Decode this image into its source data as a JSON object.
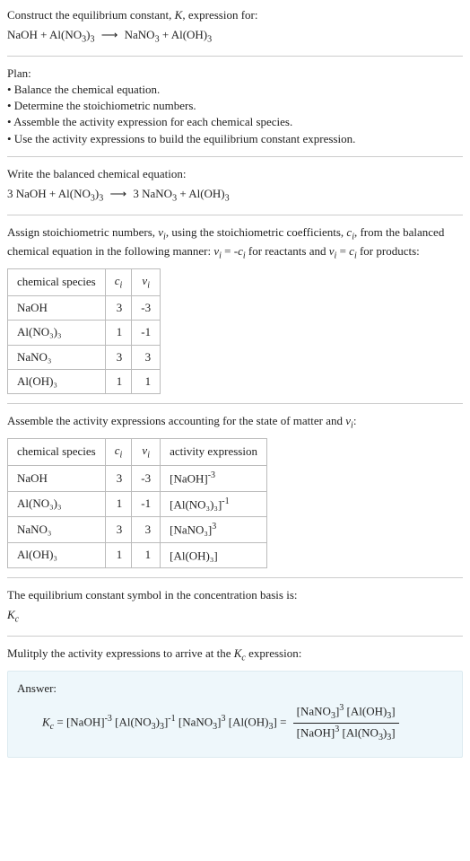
{
  "header": {
    "line1_prefix": "Construct the equilibrium constant, ",
    "line1_suffix": ", expression for:",
    "K": "K",
    "eq_left": "NaOH + Al(NO",
    "eq_left2": ")",
    "eq_right": "NaNO",
    "eq_right2": " + Al(OH)"
  },
  "plan": {
    "title": "Plan:",
    "b1": "• Balance the chemical equation.",
    "b2": "• Determine the stoichiometric numbers.",
    "b3": "• Assemble the activity expression for each chemical species.",
    "b4": "• Use the activity expressions to build the equilibrium constant expression."
  },
  "balanced": {
    "title": "Write the balanced chemical equation:",
    "p1": "3 NaOH + Al(NO",
    "p2": ")",
    "p3": "3 NaNO",
    "p4": " + Al(OH)"
  },
  "assign": {
    "t1": "Assign stoichiometric numbers, ",
    "t2": ", using the stoichiometric coefficients, ",
    "t3": ", from the balanced chemical equation in the following manner: ",
    "t4": " = -",
    "t5": " for reactants and ",
    "t6": " = ",
    "t7": " for products:",
    "nu": "ν",
    "i": "i",
    "c": "c"
  },
  "table1": {
    "h1": "chemical species",
    "h2": "c",
    "h3": "ν",
    "rows": [
      {
        "s": "NaOH",
        "c": "3",
        "v": "-3"
      },
      {
        "s": "Al(NO₃)₃",
        "c": "1",
        "v": "-1"
      },
      {
        "s": "NaNO₃",
        "c": "3",
        "v": "3"
      },
      {
        "s": "Al(OH)₃",
        "c": "1",
        "v": "1"
      }
    ]
  },
  "assemble": {
    "t1": "Assemble the activity expressions accounting for the state of matter and ",
    "t2": ":"
  },
  "table2": {
    "h1": "chemical species",
    "h2": "c",
    "h3": "ν",
    "h4": "activity expression",
    "rows": [
      {
        "s": "NaOH",
        "c": "3",
        "v": "-3",
        "a_pre": "[NaOH]",
        "a_exp": "-3"
      },
      {
        "s": "Al(NO₃)₃",
        "c": "1",
        "v": "-1",
        "a_pre": "[Al(NO₃)₃]",
        "a_exp": "-1"
      },
      {
        "s": "NaNO₃",
        "c": "3",
        "v": "3",
        "a_pre": "[NaNO₃]",
        "a_exp": "3"
      },
      {
        "s": "Al(OH)₃",
        "c": "1",
        "v": "1",
        "a_pre": "[Al(OH)₃]",
        "a_exp": ""
      }
    ]
  },
  "ksymbol": {
    "t1": "The equilibrium constant symbol in the concentration basis is:",
    "K": "K",
    "c": "c"
  },
  "multiply": {
    "t1": "Mulitply the activity expressions to arrive at the ",
    "K": "K",
    "c": "c",
    "t2": " expression:"
  },
  "answer": {
    "title": "Answer:",
    "K": "K",
    "c": "c",
    "eq": " = [NaOH]",
    "e1": "-3",
    "t2": " [Al(NO",
    "t3": ")",
    "t4": "]",
    "e2": "-1",
    "t5": " [NaNO",
    "t6": "]",
    "e3": "3",
    "t7": " [Al(OH)",
    "t8": "] = ",
    "num1": "[NaNO",
    "num2": "]",
    "nume3": "3",
    "num3": " [Al(OH)",
    "num4": "]",
    "den1": "[NaOH]",
    "dene1": "3",
    "den2": " [Al(NO",
    "den3": ")",
    "den4": "]"
  },
  "sub3": "3",
  "arrow": "⟶"
}
